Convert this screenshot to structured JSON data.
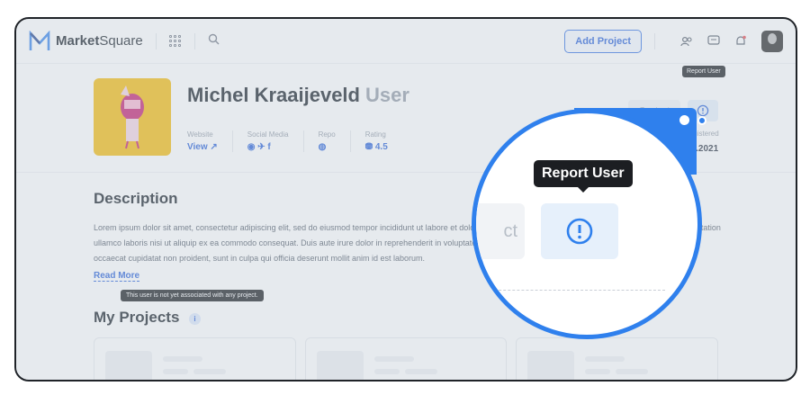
{
  "brand": {
    "name_bold": "Market",
    "name_rest": "Square"
  },
  "topbar": {
    "add_project": "Add Project",
    "icons": [
      "grid-icon",
      "search-icon",
      "people-icon",
      "chat-icon",
      "bell-icon"
    ]
  },
  "profile": {
    "name": "Michel Kraaijeveld",
    "role": "User",
    "contact": "Contact",
    "meta": [
      {
        "label": "Website",
        "value": "View ↗"
      },
      {
        "label": "Social Media",
        "value": "◉ ✈ f"
      },
      {
        "label": "Repo",
        "value": "◍"
      },
      {
        "label": "Rating",
        "value": "⛃ 4.5"
      }
    ],
    "registered_label": "Registered",
    "registered_value": "01.2021"
  },
  "tooltip_small": "Report User",
  "description": {
    "title": "Description",
    "text": "Lorem ipsum dolor sit amet, consectetur adipiscing elit, sed do eiusmod tempor incididunt ut labore et dolore magna aliqua. Ut enim ad minim veniam, quis nostrud exercitation ullamco laboris nisi ut aliquip ex ea commodo consequat. Duis aute irure dolor in reprehenderit in voluptate velit esse cillum dolore eu fugiat nulla pariatur. Excepteur sint occaecat cupidatat non proident, sunt in culpa qui officia deserunt mollit anim id est laborum.",
    "read_more": "Read More"
  },
  "projects": {
    "tooltip": "This user is not yet associated with any project.",
    "title": "My Projects",
    "info": "i"
  },
  "magnifier": {
    "tooltip": "Report User",
    "contact_fragment": "ct"
  },
  "colors": {
    "accent": "#2f80ed",
    "link": "#1f5bd8",
    "pfp_bg": "#f5b800"
  }
}
